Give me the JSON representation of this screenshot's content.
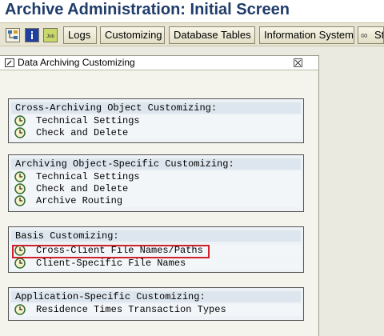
{
  "window": {
    "title": "Archive Administration: Initial Screen"
  },
  "toolbar": {
    "icons": [
      "tree-icon",
      "info-icon",
      "job-icon"
    ],
    "job_icon_text": "Job",
    "buttons": [
      "Logs",
      "Customizing",
      "Database Tables",
      "Information System",
      "St"
    ]
  },
  "panel": {
    "title": "Data Archiving Customizing",
    "groups": [
      {
        "header": "Cross-Archiving Object Customizing:",
        "items": [
          "Technical Settings",
          "Check and Delete"
        ]
      },
      {
        "header": "Archiving Object-Specific Customizing:",
        "items": [
          "Technical Settings",
          "Check and Delete",
          "Archive Routing"
        ]
      },
      {
        "header": "Basis Customizing:",
        "items": [
          "Cross-Client File Names/Paths",
          "Client-Specific File Names"
        ]
      },
      {
        "header": "Application-Specific Customizing:",
        "items": [
          "Residence Times Transaction Types"
        ]
      }
    ]
  },
  "colors": {
    "title": "#1f3c6a",
    "highlight": "#d0202a",
    "group_header_bg": "#dde6ee"
  }
}
